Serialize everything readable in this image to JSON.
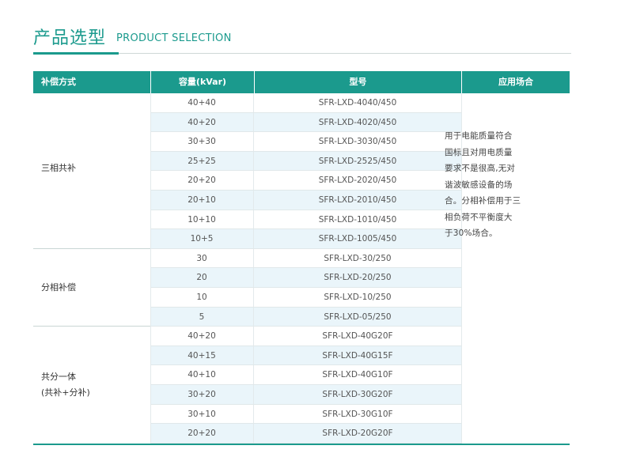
{
  "header": {
    "title_cn": "产品选型",
    "title_en": "PRODUCT SELECTION"
  },
  "table": {
    "headers": [
      "补偿方式",
      "容量(kVar)",
      "型号",
      "应用场合"
    ],
    "groups": [
      {
        "label": "三相共补",
        "label2": ""
      },
      {
        "label": "分相补偿",
        "label2": ""
      },
      {
        "label": "共分一体",
        "label2": "(共补+分补)"
      }
    ],
    "rows": [
      {
        "capacity": "40+40",
        "model": "SFR-LXD-4040/450"
      },
      {
        "capacity": "40+20",
        "model": "SFR-LXD-4020/450"
      },
      {
        "capacity": "30+30",
        "model": "SFR-LXD-3030/450"
      },
      {
        "capacity": "25+25",
        "model": "SFR-LXD-2525/450"
      },
      {
        "capacity": "20+20",
        "model": "SFR-LXD-2020/450"
      },
      {
        "capacity": "20+10",
        "model": "SFR-LXD-2010/450"
      },
      {
        "capacity": "10+10",
        "model": "SFR-LXD-1010/450"
      },
      {
        "capacity": "10+5",
        "model": "SFR-LXD-1005/450"
      },
      {
        "capacity": "30",
        "model": "SFR-LXD-30/250"
      },
      {
        "capacity": "20",
        "model": "SFR-LXD-20/250"
      },
      {
        "capacity": "10",
        "model": "SFR-LXD-10/250"
      },
      {
        "capacity": "5",
        "model": "SFR-LXD-05/250"
      },
      {
        "capacity": "40+20",
        "model": "SFR-LXD-40G20F"
      },
      {
        "capacity": "40+15",
        "model": "SFR-LXD-40G15F"
      },
      {
        "capacity": "40+10",
        "model": "SFR-LXD-40G10F"
      },
      {
        "capacity": "30+20",
        "model": "SFR-LXD-30G20F"
      },
      {
        "capacity": "30+10",
        "model": "SFR-LXD-30G10F"
      },
      {
        "capacity": "20+20",
        "model": "SFR-LXD-20G20F"
      }
    ],
    "application": [
      "用于电能质量符合",
      "国标且对用电质量",
      "要求不是很高,无对",
      "谐波敏感设备的场",
      "合。分相补偿用于三",
      "相负荷不平衡度大",
      "于30%场合。"
    ]
  },
  "colors": {
    "accent": "#1b9a8d",
    "row_alt": "#eaf5fa"
  }
}
